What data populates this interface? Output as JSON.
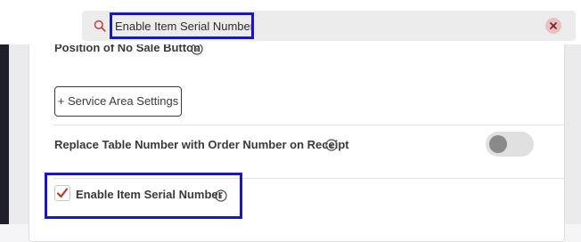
{
  "search": {
    "value": "Enable Item Serial Number",
    "placeholder": ""
  },
  "settings": {
    "clipped_label": "Position of No Sale Button",
    "service_area_button": "+ Service Area Settings",
    "replace_table_label": "Replace Table Number with Order Number on Receipt",
    "replace_table_toggle": "off",
    "enable_serial_label": "Enable Item Serial Number",
    "enable_serial_checked": true
  },
  "icons": {
    "search": "search-icon",
    "clear": "close-icon",
    "info": "info-icon",
    "check": "checkmark-icon"
  },
  "colors": {
    "highlight": "#1716c8",
    "check": "#c0392b",
    "clear_bg": "#e8c2c2"
  }
}
